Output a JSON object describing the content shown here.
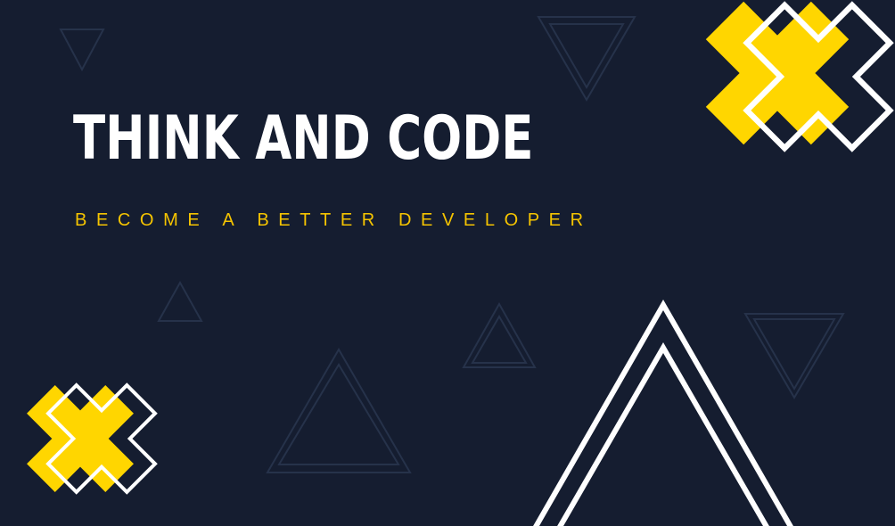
{
  "banner": {
    "title": "THINK AND CODE",
    "subtitle": "BECOME A BETTER DEVELOPER"
  },
  "colors": {
    "background": "#151d30",
    "accent": "#ffd600",
    "outline": "#ffffff",
    "faint_line": "#26324a"
  },
  "decorations": {
    "icons": [
      "x-cross-icon",
      "triangle-outline-icon"
    ]
  }
}
